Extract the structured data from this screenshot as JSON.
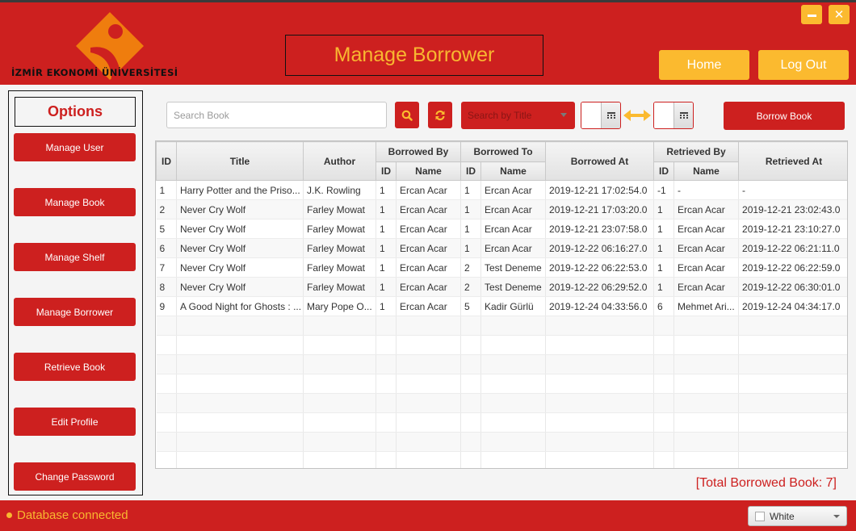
{
  "window": {
    "minimize_label": "–",
    "close_label": "✕"
  },
  "header": {
    "logo_text": "İZMİR EKONOMİ ÜNİVERSİTESİ",
    "title": "Manage Borrower",
    "home_label": "Home",
    "logout_label": "Log Out"
  },
  "sidebar": {
    "title": "Options",
    "items": [
      {
        "label": "Manage User"
      },
      {
        "label": "Manage Book"
      },
      {
        "label": "Manage Shelf"
      },
      {
        "label": "Manage Borrower"
      },
      {
        "label": "Retrieve Book"
      },
      {
        "label": "Edit Profile"
      },
      {
        "label": "Change Password"
      }
    ]
  },
  "toolbar": {
    "search_placeholder": "Search Book",
    "search_value": "",
    "search_by": "Search by Title",
    "from_date": "",
    "to_date": "",
    "borrow_label": "Borrow Book"
  },
  "table": {
    "headers": {
      "id": "ID",
      "title": "Title",
      "author": "Author",
      "borrowed_by": "Borrowed By",
      "borrowed_to": "Borrowed To",
      "borrowed_at": "Borrowed At",
      "retrieved_by": "Retrieved By",
      "retrieved_at": "Retrieved At",
      "sub_id": "ID",
      "sub_name": "Name"
    },
    "rows": [
      [
        "1",
        "Harry Potter and the Priso...",
        "J.K. Rowling",
        "1",
        "Ercan Acar",
        "1",
        "Ercan Acar",
        "2019-12-21 17:02:54.0",
        "-1",
        "-",
        "-"
      ],
      [
        "2",
        "Never Cry Wolf",
        "Farley Mowat",
        "1",
        "Ercan Acar",
        "1",
        "Ercan Acar",
        "2019-12-21 17:03:20.0",
        "1",
        "Ercan Acar",
        "2019-12-21 23:02:43.0"
      ],
      [
        "5",
        "Never Cry Wolf",
        "Farley Mowat",
        "1",
        "Ercan Acar",
        "1",
        "Ercan Acar",
        "2019-12-21 23:07:58.0",
        "1",
        "Ercan Acar",
        "2019-12-21 23:10:27.0"
      ],
      [
        "6",
        "Never Cry Wolf",
        "Farley Mowat",
        "1",
        "Ercan Acar",
        "1",
        "Ercan Acar",
        "2019-12-22 06:16:27.0",
        "1",
        "Ercan Acar",
        "2019-12-22 06:21:11.0"
      ],
      [
        "7",
        "Never Cry Wolf",
        "Farley Mowat",
        "1",
        "Ercan Acar",
        "2",
        "Test Deneme",
        "2019-12-22 06:22:53.0",
        "1",
        "Ercan Acar",
        "2019-12-22 06:22:59.0"
      ],
      [
        "8",
        "Never Cry Wolf",
        "Farley Mowat",
        "1",
        "Ercan Acar",
        "2",
        "Test Deneme",
        "2019-12-22 06:29:52.0",
        "1",
        "Ercan Acar",
        "2019-12-22 06:30:01.0"
      ],
      [
        "9",
        "A Good Night for Ghosts : ...",
        "Mary Pope O...",
        "1",
        "Ercan Acar",
        "5",
        "Kadir Gürlü",
        "2019-12-24 04:33:56.0",
        "6",
        "Mehmet Ari...",
        "2019-12-24 04:34:17.0"
      ]
    ]
  },
  "summary": {
    "total_text": "[Total Borrowed Book: 7]"
  },
  "footer": {
    "status_text": "Database connected",
    "theme_value": "White"
  },
  "colors": {
    "primary_red": "#cd201f",
    "accent_yellow": "#fbba2f",
    "title_yellow": "#f8b730",
    "logo_orange": "#ef7d0e"
  }
}
